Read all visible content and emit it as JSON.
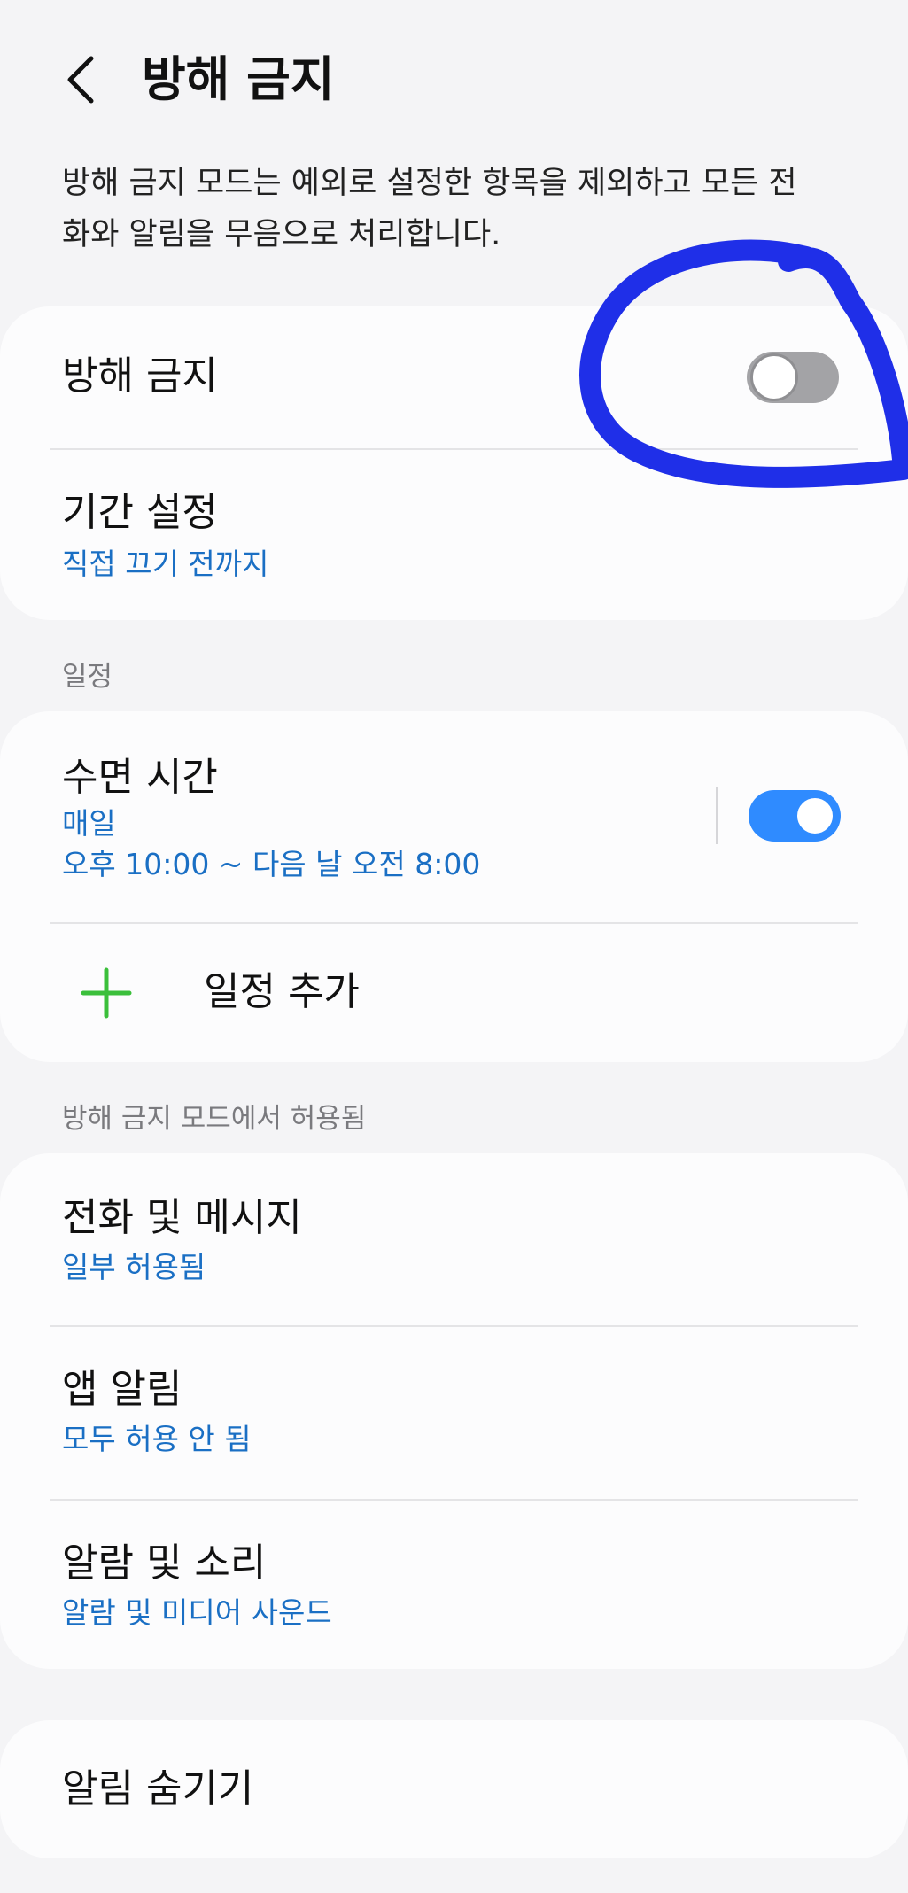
{
  "header": {
    "title": "방해 금지"
  },
  "description": "방해 금지 모드는 예외로 설정한 항목을 제외하고 모든 전화와 알림을 무음으로 처리합니다.",
  "main_card": {
    "dnd_toggle_label": "방해 금지",
    "dnd_enabled": false,
    "duration_title": "기간 설정",
    "duration_value": "직접 끄기 전까지"
  },
  "schedule": {
    "section_label": "일정",
    "sleep_title": "수면 시간",
    "sleep_repeat": "매일",
    "sleep_time": "오후 10:00 ~ 다음 날 오전 8:00",
    "sleep_enabled": true,
    "add_label": "일정 추가"
  },
  "allowed": {
    "section_label": "방해 금지 모드에서 허용됨",
    "items": [
      {
        "title": "전화 및 메시지",
        "value": "일부 허용됨"
      },
      {
        "title": "앱 알림",
        "value": "모두 허용 안 됨"
      },
      {
        "title": "알람 및 소리",
        "value": "알람 및 미디어 사운드"
      }
    ]
  },
  "hide": {
    "title": "알림 숨기기"
  },
  "colors": {
    "accent": "#2f8bff",
    "link_text": "#1a6fc4",
    "annotation": "#1f2fe8",
    "add_icon": "#3bbf3b"
  },
  "icons": {
    "back": "chevron-left-icon",
    "add": "plus-icon"
  }
}
